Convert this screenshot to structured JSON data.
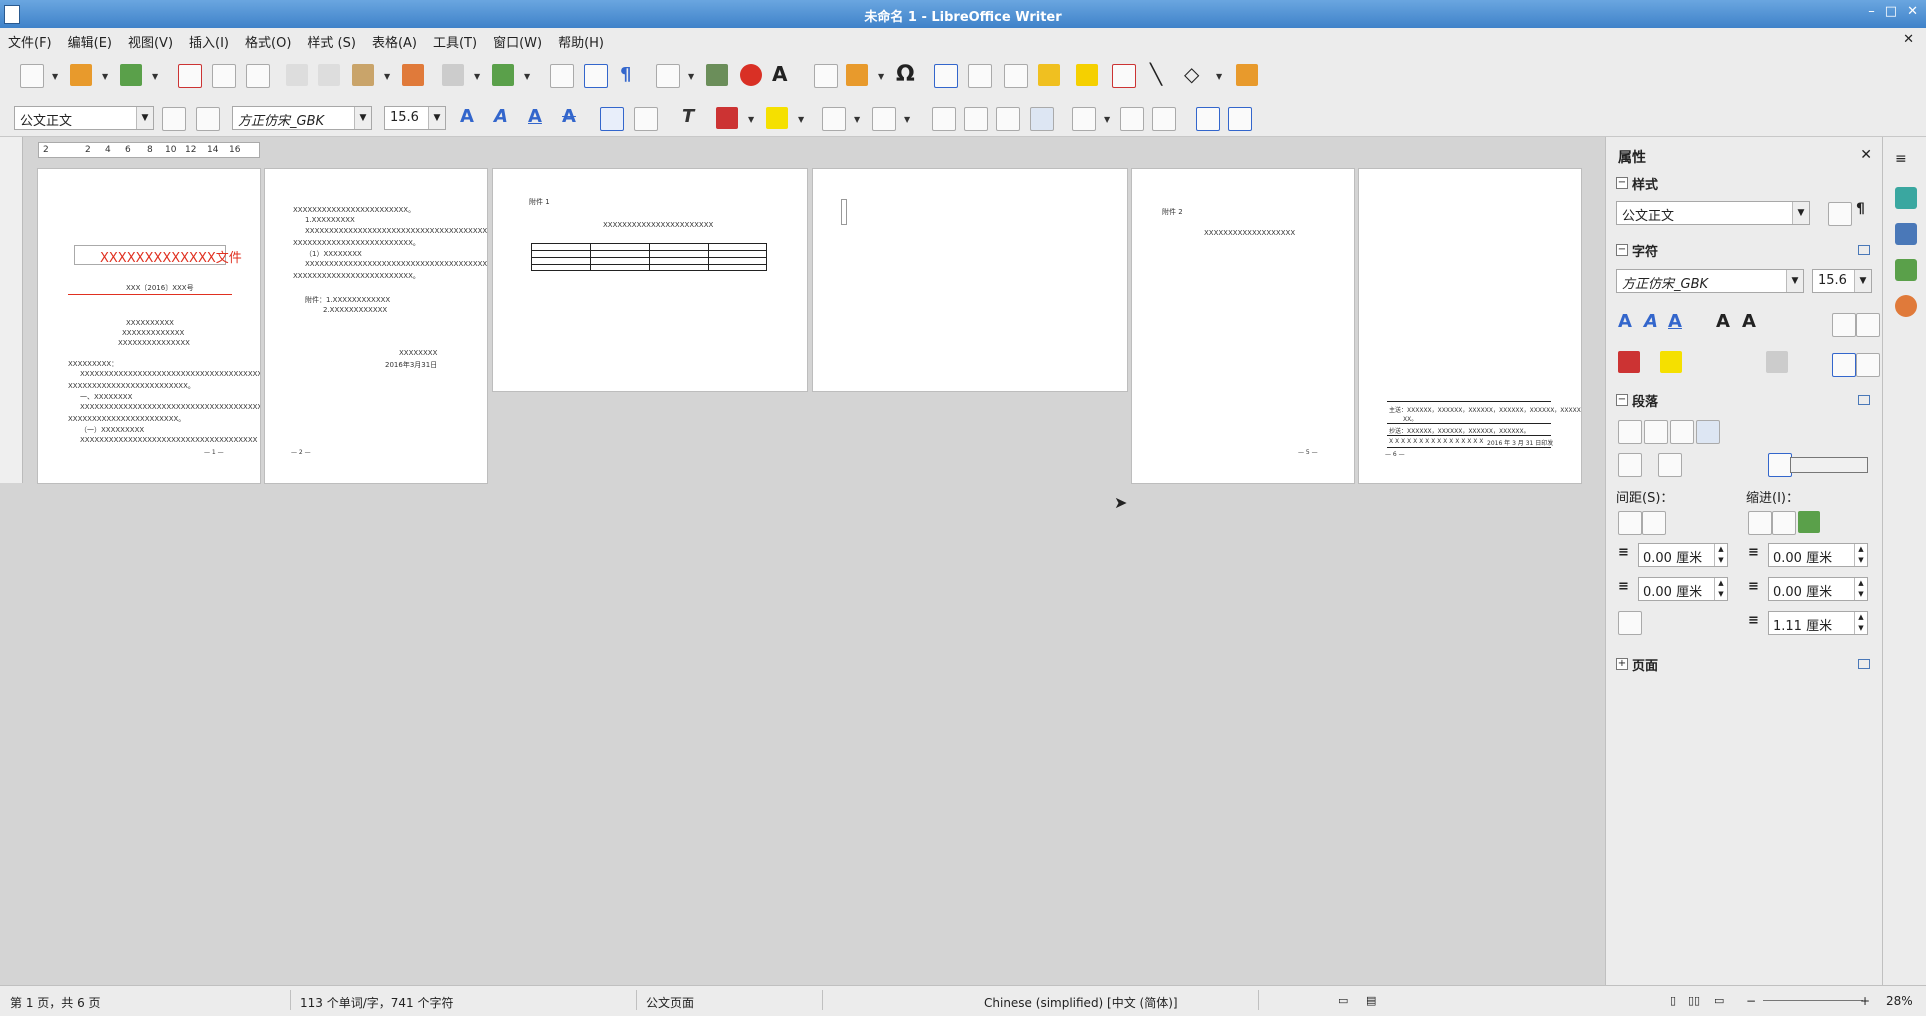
{
  "window": {
    "title": "未命名 1 - LibreOffice Writer"
  },
  "menu": [
    "文件(F)",
    "编辑(E)",
    "视图(V)",
    "插入(I)",
    "格式(O)",
    "样式 (S)",
    "表格(A)",
    "工具(T)",
    "窗口(W)",
    "帮助(H)"
  ],
  "formatting": {
    "paragraph_style": "公文正文",
    "font_name": "方正仿宋_GBK",
    "font_size": "15.6"
  },
  "ruler": {
    "marks": [
      "2",
      "2",
      "4",
      "6",
      "8",
      "10",
      "12",
      "14",
      "16"
    ]
  },
  "pages": {
    "p1": {
      "title": "XXXXXXXXXXXXX文件",
      "docno": "XXX〔2016〕XXX号",
      "h1": "XXXXXXXXXX",
      "h2": "XXXXXXXXXXXXX",
      "h3": "XXXXXXXXXXXXXXX",
      "l1": "XXXXXXXXX：",
      "l2": "XXXXXXXXXXXXXXXXXXXXXXXXXXXXXXXXXXXXXX",
      "l3": "XXXXXXXXXXXXXXXXXXXXXXXXX。",
      "l4": "一、XXXXXXXX",
      "l5": "XXXXXXXXXXXXXXXXXXXXXXXXXXXXXXXXXXXXXX",
      "l6": "XXXXXXXXXXXXXXXXXXXXXXX。",
      "l7": "（一）XXXXXXXXX",
      "l8": "XXXXXXXXXXXXXXXXXXXXXXXXXXXXXXXXXXXXX",
      "footer": "— 1 —"
    },
    "p2": {
      "l1": "XXXXXXXXXXXXXXXXXXXXXXXX。",
      "l2": "1.XXXXXXXXX",
      "l3": "XXXXXXXXXXXXXXXXXXXXXXXXXXXXXXXXXXXXXX",
      "l4": "XXXXXXXXXXXXXXXXXXXXXXXXX。",
      "l5": "（1）XXXXXXXX",
      "l6": "XXXXXXXXXXXXXXXXXXXXXXXXXXXXXXXXXXXXXX",
      "l7": "XXXXXXXXXXXXXXXXXXXXXXXXX。",
      "att1": "附件：1.XXXXXXXXXXXX",
      "att2": "2.XXXXXXXXXXXX",
      "sign": "XXXXXXXX",
      "date": "2016年3月31日",
      "footer": "— 2 —"
    },
    "p3": {
      "label": "附件 1",
      "title": "XXXXXXXXXXXXXXXXXXXXXXX"
    },
    "p5": {
      "label": "附件 2",
      "title": "XXXXXXXXXXXXXXXXXXX",
      "footer": "— 5 —"
    },
    "p6": {
      "l1": "主送：XXXXXX，XXXXXX，XXXXXX，XXXXXX，XXXXXX，XXXXXX，XXXX",
      "l2": "XX。",
      "l3": "抄送：XXXXXX，XXXXXX，XXXXXX，XXXXXX。",
      "l4": "X X X X X X X X X X X X X X X X",
      "l5": "2016 年 3 月 31 日印发",
      "footer": "— 6 —"
    }
  },
  "sidebar": {
    "header": "属性",
    "sections": {
      "style": "样式",
      "character": "字符",
      "paragraph": "段落",
      "page": "页面"
    },
    "style_value": "公文正文",
    "font_value": "方正仿宋_GBK",
    "size_value": "15.6",
    "spacing_label": "间距(S)：",
    "indent_label": "缩进(I)：",
    "above": "0.00 厘米",
    "below": "0.00 厘米",
    "indent_before": "0.00 厘米",
    "indent_after": "0.00 厘米",
    "first_line": "1.11 厘米"
  },
  "status": {
    "page": "第 1 页，共 6 页",
    "words": "113 个单词/字，741 个字符",
    "page_style": "公文页面",
    "language": "Chinese (simplified) [中文 (简体)]",
    "zoom": "28%"
  },
  "colors": {
    "title_red": "#e03020",
    "accent": "#3f82c9"
  },
  "icons": [
    "new-icon",
    "open-icon",
    "save-icon",
    "export-pdf-icon",
    "print-icon",
    "print-preview-icon",
    "cut-icon",
    "copy-icon",
    "paste-icon",
    "clone-formatting-icon",
    "undo-icon",
    "redo-icon",
    "find-replace-icon",
    "spellcheck-icon",
    "formatting-marks-icon",
    "table-icon",
    "image-icon",
    "chart-icon",
    "fontwork-icon",
    "page-break-icon",
    "field-icon",
    "special-character-icon",
    "hyperlink-icon",
    "footnote-icon",
    "endnote-icon",
    "bookmark-icon",
    "comment-icon",
    "track-changes-icon",
    "line-icon",
    "shapes-icon",
    "draw-functions-icon"
  ]
}
